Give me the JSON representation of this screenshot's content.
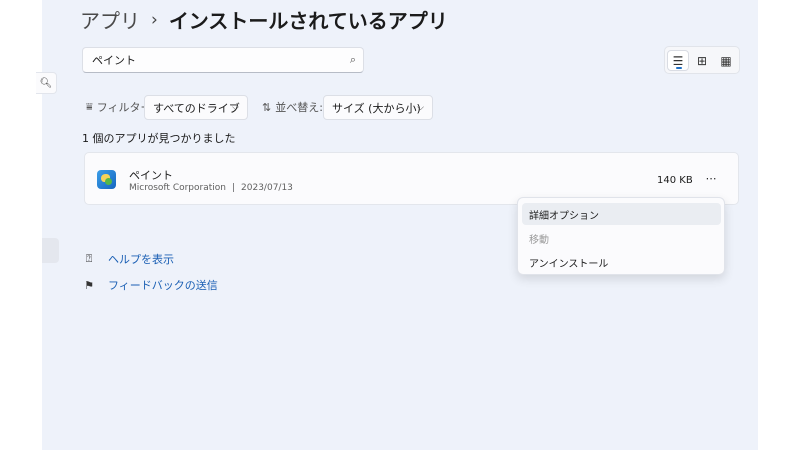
{
  "breadcrumb": {
    "parent": "アプリ",
    "separator": "›",
    "current": "インストールされているアプリ"
  },
  "search": {
    "value": "ペイント"
  },
  "filters": {
    "filter_label": "フィルター:",
    "filter_value": "すべてのドライブ",
    "sort_label": "並べ替え:",
    "sort_value": "サイズ (大から小)"
  },
  "results": {
    "count_text": "1 個のアプリが見つかりました"
  },
  "apps": [
    {
      "name": "ペイント",
      "publisher": "Microsoft Corporation",
      "separator": "|",
      "date": "2023/07/13",
      "size": "140 KB"
    }
  ],
  "context_menu": {
    "items": [
      {
        "label": "詳細オプション",
        "state": "hover"
      },
      {
        "label": "移動",
        "state": "disabled"
      },
      {
        "label": "アンインストール",
        "state": "normal"
      }
    ]
  },
  "links": {
    "help": "ヘルプを表示",
    "feedback": "フィードバックの送信"
  },
  "icons": {
    "search": "search-icon",
    "list_view": "list-view-icon",
    "grid_view": "grid-view-icon",
    "tile_view": "tile-view-icon",
    "filter": "filter-icon",
    "sort": "sort-icon",
    "more": "more-icon",
    "help": "help-icon",
    "feedback": "feedback-icon"
  },
  "colors": {
    "background": "#eef2fa",
    "accent": "#1f6fc5",
    "link": "#1a5fb4"
  }
}
